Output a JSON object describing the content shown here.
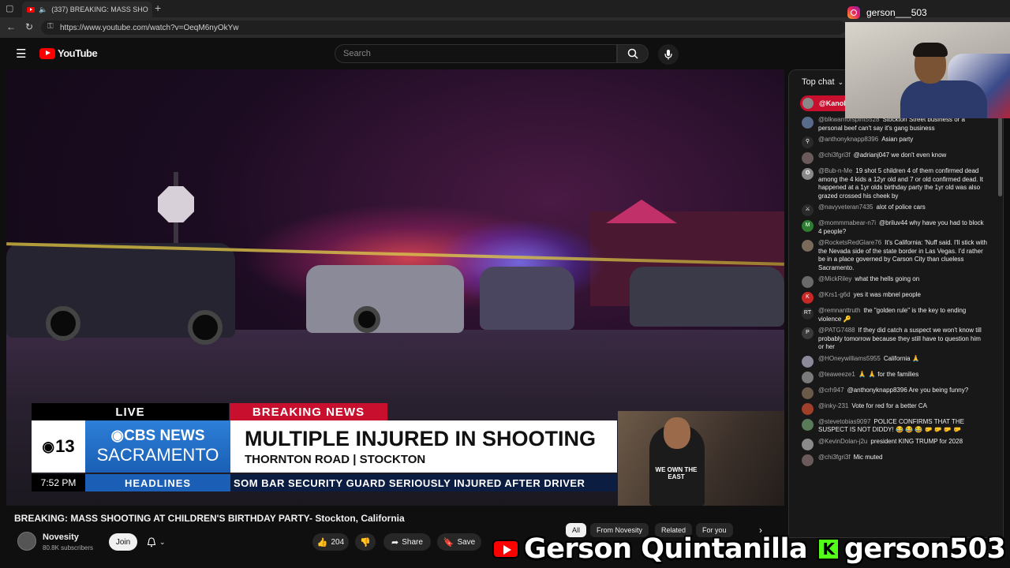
{
  "browser": {
    "tab_title": "(337) BREAKING: MASS SHO",
    "url": "https://www.youtube.com/watch?v=OeqM6nyOkYw"
  },
  "header": {
    "logo_text": "YouTube",
    "search_placeholder": "Search"
  },
  "video": {
    "chyron": {
      "live": "LIVE",
      "breaking": "BREAKING NEWS",
      "station_number": "13",
      "network_line1": "CBS NEWS",
      "network_line2": "SACRAMENTO",
      "headline": "MULTIPLE INJURED IN SHOOTING",
      "subheadline": "THORNTON ROAD | STOCKTON",
      "time": "7:52 PM",
      "section": "HEADLINES",
      "ticker": "SOM BAR SECURITY GUARD SERIOUSLY INJURED AFTER DRIVER"
    },
    "inset_shirt_text": "WE OWN THE EAST"
  },
  "below_video": {
    "title": "BREAKING: MASS SHOOTING AT CHILDREN'S BIRTHDAY PARTY- Stockton, California",
    "channel_name": "Novesity",
    "subscribers": "80.8K subscribers",
    "join_label": "Join",
    "likes": "204",
    "share_label": "Share",
    "save_label": "Save"
  },
  "chips": [
    {
      "label": "All",
      "active": true
    },
    {
      "label": "From Novesity"
    },
    {
      "label": "Related"
    },
    {
      "label": "For you"
    }
  ],
  "chat": {
    "mode_label": "Top chat",
    "pinned_author": "@KanoD",
    "messages": [
      {
        "author": "@blkwarriorspirit5528",
        "text": "Stockton Street business or a personal beef can't say it's gang business",
        "avatar_color": "#5a6a8a",
        "initial": ""
      },
      {
        "author": "@anthonyknapp8396",
        "text": "Asian party",
        "avatar_color": "#2a2a2a",
        "initial": "⚲"
      },
      {
        "author": "@chi3fgri3f",
        "text": "@adrianj047 we don't even know",
        "avatar_color": "#6a5a5a",
        "initial": ""
      },
      {
        "author": "@Bub-n-Me",
        "text": "19 shot 5 children 4 of them confirmed dead among the 4 kids a 12yr old and 7 or old confirmed dead. It happened at a 1yr olds birthday party the 1yr old was also grazed crossed his cheek by",
        "avatar_color": "#8a8a8a",
        "initial": "✪"
      },
      {
        "author": "@navyveteran7435",
        "text": "alot of police cars",
        "avatar_color": "#2a2a2a",
        "initial": "⚔"
      },
      {
        "author": "@mommmabear-n7i",
        "text": "@briluv44 why have you had to block 4 people?",
        "avatar_color": "#2e7d32",
        "initial": "M"
      },
      {
        "author": "@RocketsRedGlare76",
        "text": "It's California: 'Nuff said. I'll stick with the Nevada side of the state border in Las Vegas. I'd rather be in a place governed by Carson City than clueless Sacramento.",
        "avatar_color": "#7a6a5a",
        "initial": ""
      },
      {
        "author": "@MickRiley",
        "text": "what the hells going on",
        "avatar_color": "#6a6a6a",
        "initial": ""
      },
      {
        "author": "@Krs1-g6d",
        "text": "yes it was mbnel people",
        "avatar_color": "#c62828",
        "initial": "K"
      },
      {
        "author": "@remnanttruth",
        "text": "the \"golden rule\" is the key to ending violence 🔑",
        "avatar_color": "#2a2a2a",
        "initial": "RT"
      },
      {
        "author": "@PATG7488",
        "text": "If they did catch a suspect we won't know till probably tomorrow because they still have to question him or her",
        "avatar_color": "#3a3a3a",
        "initial": "P"
      },
      {
        "author": "@HOneywilliams5955",
        "text": "California 🙏",
        "avatar_color": "#8a8a9a",
        "initial": ""
      },
      {
        "author": "@teaweeze1",
        "text": "🙏 🙏 for the families",
        "avatar_color": "#7a7a7a",
        "initial": ""
      },
      {
        "author": "@crh947",
        "text": "@anthonyknapp8396 Are you being funny?",
        "avatar_color": "#6a5a4a",
        "initial": ""
      },
      {
        "author": "@inky-231",
        "text": "Vote for red for a better CA",
        "avatar_color": "#a0402a",
        "initial": ""
      },
      {
        "author": "@stevetobias9097",
        "text": "POLICE CONFIRMS THAT THE SUSPECT IS NOT DIDDY! 😂 😂 😂 🤛 🤛 🤛 🤛",
        "avatar_color": "#5a7a5a",
        "initial": ""
      },
      {
        "author": "@KevinDolan-j2u",
        "text": "president KING TRUMP for 2028",
        "avatar_color": "#8a8a8a",
        "initial": ""
      },
      {
        "author": "@chi3fgri3f",
        "text": "Mic muted",
        "avatar_color": "#6a5a5a",
        "initial": ""
      }
    ]
  },
  "streamer": {
    "instagram_handle": "gerson___503",
    "youtube_name": "Gerson Quintanilla",
    "kick_name": "gerson503"
  }
}
